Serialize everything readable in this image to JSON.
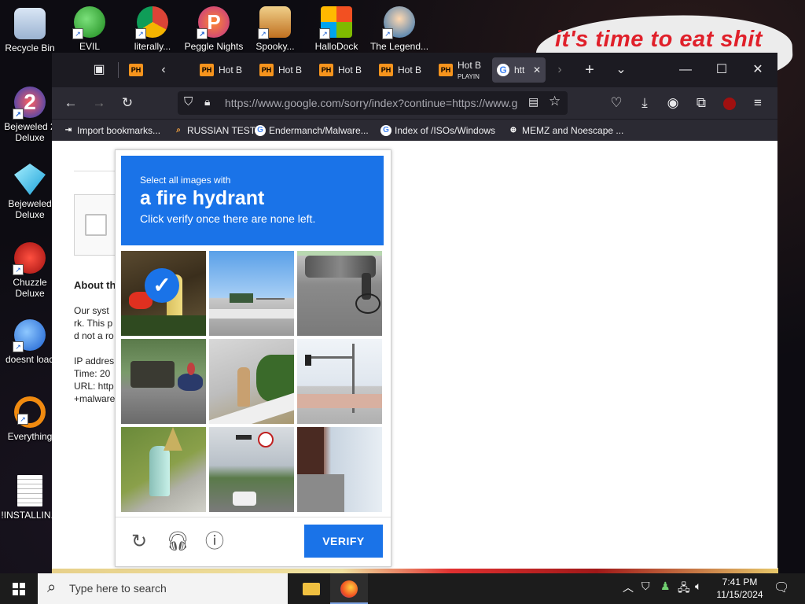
{
  "speech_bubble": "it's time to eat shit",
  "desktop_icons": [
    {
      "label": "Recycle Bin"
    },
    {
      "label": "EVIL GREEN..."
    },
    {
      "label": "literally..."
    },
    {
      "label": "Peggle Nights"
    },
    {
      "label": "Spooky..."
    },
    {
      "label": "HalloDock"
    },
    {
      "label": "The Legend..."
    },
    {
      "label": "Bejeweled 2 Deluxe"
    },
    {
      "label": "Bejeweled Deluxe"
    },
    {
      "label": "Chuzzle Deluxe"
    },
    {
      "label": "doesnt load"
    },
    {
      "label": "Everything"
    },
    {
      "label": "!INSTALLIN..."
    }
  ],
  "browser": {
    "tabs": [
      {
        "label": "Hot B"
      },
      {
        "label": "Hot B"
      },
      {
        "label": "Hot B"
      },
      {
        "label": "Hot B"
      },
      {
        "label": "Hot B",
        "sub": "PLAYIN"
      },
      {
        "label": "htt"
      }
    ],
    "favicon_ph": "PH",
    "favicon_g": "G",
    "url": "https://www.google.com/sorry/index?continue=https://www.g",
    "bookmarks": [
      {
        "label": "Import bookmarks..."
      },
      {
        "label": "RUSSIAN TEST"
      },
      {
        "label": "Endermanch/Malware..."
      },
      {
        "label": "Index of /ISOs/Windows"
      },
      {
        "label": "MEMZ and Noescape ..."
      }
    ],
    "page": {
      "heading": "About th",
      "lines": [
        "Our syst",
        "rk. This p",
        "d not a ro",
        "IP addres",
        "Time: 20",
        "URL: http",
        "+malware"
      ]
    }
  },
  "captcha": {
    "line1": "Select all images with",
    "target": "a fire hydrant",
    "line3": "Click verify once there are none left.",
    "verify_label": "VERIFY",
    "tiles": [
      {
        "name": "hydrant-red-grass",
        "selected": true
      },
      {
        "name": "highway-sign",
        "selected": false
      },
      {
        "name": "cyclist-street",
        "selected": false
      },
      {
        "name": "truck-motorbike",
        "selected": false
      },
      {
        "name": "hydrant-curb",
        "selected": false
      },
      {
        "name": "traffic-light-lot",
        "selected": false
      },
      {
        "name": "hydrant-white-grass",
        "selected": false
      },
      {
        "name": "city-street-signs",
        "selected": false
      },
      {
        "name": "building-sky",
        "selected": false
      }
    ]
  },
  "taskbar": {
    "search_placeholder": "Type here to search",
    "time": "7:41 PM",
    "date": "11/15/2024"
  }
}
